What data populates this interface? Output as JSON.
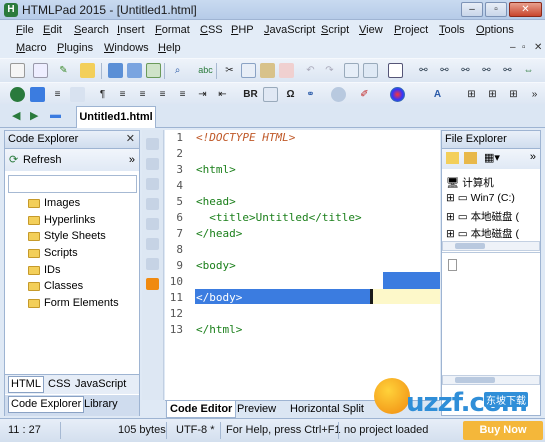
{
  "window": {
    "title": "HTMLPad 2015 - [Untitled1.html]",
    "logo_letter": "H"
  },
  "menu": {
    "row1": [
      "File",
      "Edit",
      "Search",
      "Insert",
      "Format",
      "CSS",
      "PHP",
      "JavaScript",
      "Script",
      "View",
      "Project",
      "Tools",
      "Options"
    ],
    "row2": [
      "Macro",
      "Plugins",
      "Windows",
      "Help"
    ]
  },
  "toolbar2": {
    "br_label": "BR"
  },
  "document_tab": {
    "label": "Untitled1.html"
  },
  "code_explorer": {
    "title": "Code Explorer",
    "refresh_label": "Refresh",
    "items": [
      "Images",
      "Hyperlinks",
      "Style Sheets",
      "Scripts",
      "IDs",
      "Classes",
      "Form Elements"
    ],
    "lang_tabs": [
      "HTML",
      "CSS",
      "JavaScript"
    ],
    "bottom_tabs": [
      "Code Explorer",
      "Library"
    ]
  },
  "editor": {
    "line_numbers": [
      "1",
      "2",
      "3",
      "4",
      "5",
      "6",
      "7",
      "8",
      "9",
      "10",
      "11",
      "12",
      "13"
    ],
    "lines": [
      "<!DOCTYPE HTML>",
      "",
      "<html>",
      "",
      "<head>",
      "  <title>Untitled</title>",
      "</head>",
      "",
      "<body>",
      "",
      "</body>",
      "",
      "</html>"
    ],
    "view_tabs": [
      "Code Editor",
      "Preview",
      "Horizontal Split"
    ]
  },
  "file_explorer": {
    "title": "File Explorer",
    "items": [
      "计算机",
      "Win7 (C:)",
      "本地磁盘 (",
      "本地磁盘 ("
    ]
  },
  "status": {
    "position": "11 : 27",
    "size": "105 bytes",
    "encoding": "UTF-8 *",
    "help": "For Help, press Ctrl+F1",
    "project": "no project loaded",
    "buy": "Buy Now"
  },
  "watermark": {
    "text": "uzzf.com",
    "cn": "东坡下载"
  },
  "colors": {
    "accent": "#3b7ce0",
    "tag": "#1a7f1a",
    "doctype": "#c05a2a",
    "buy": "#f4b73a"
  }
}
